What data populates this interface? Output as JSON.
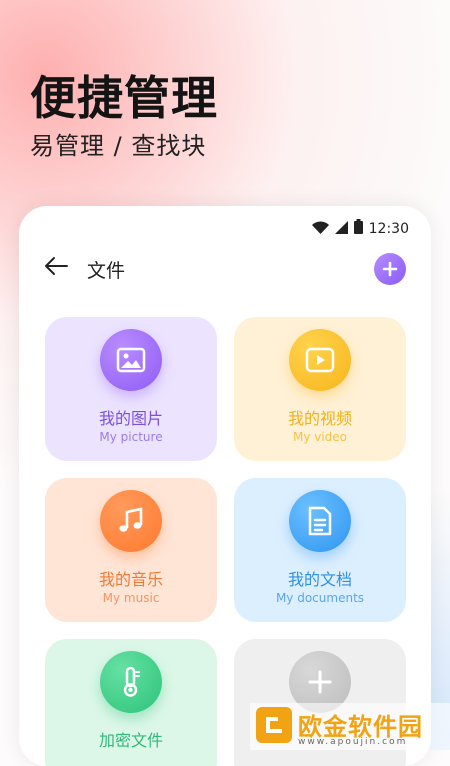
{
  "hero": {
    "headline": "便捷管理",
    "subline": "易管理 / 查找块"
  },
  "status_bar": {
    "time": "12:30",
    "icons": [
      "wifi-icon",
      "signal-icon",
      "battery-icon"
    ]
  },
  "topbar": {
    "back_icon": "arrow-left-icon",
    "title": "文件",
    "add_icon": "plus-icon"
  },
  "categories": [
    {
      "label_cn": "我的图片",
      "label_en": "My picture",
      "icon": "image-icon",
      "color": "#8e5cf5"
    },
    {
      "label_cn": "我的视频",
      "label_en": "My video",
      "icon": "play-icon",
      "color": "#f7b51c"
    },
    {
      "label_cn": "我的音乐",
      "label_en": "My music",
      "icon": "music-note-icon",
      "color": "#ff7a2e"
    },
    {
      "label_cn": "我的文档",
      "label_en": "My documents",
      "icon": "document-icon",
      "color": "#2f95f0"
    },
    {
      "label_cn": "加密文件",
      "icon": "thermometer-lock-icon",
      "color": "#2cc47a"
    },
    {
      "icon": "plus-icon",
      "color": "#bdbdbd"
    }
  ],
  "watermark": {
    "name": "欧金软件园",
    "url": "www.apoujin.com"
  }
}
